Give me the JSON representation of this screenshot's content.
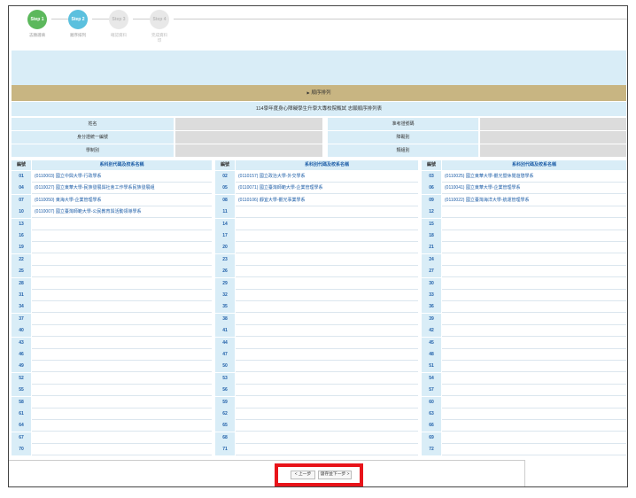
{
  "steps": [
    {
      "label": "Step 1",
      "caption": "志願選填",
      "state": "done"
    },
    {
      "label": "Step 2",
      "caption": "順序排列",
      "state": "current"
    },
    {
      "label": "Step 3",
      "caption": "確認資料",
      "state": "todo"
    },
    {
      "label": "Step 4",
      "caption": "完成資料\n印",
      "state": "todo"
    }
  ],
  "section_title": "順序排列",
  "section_arrow": "▶",
  "exam_title": "114學年度身心障礙學生升學大專校院甄試 志願順序排列表",
  "info": {
    "name_label": "姓名",
    "exam_no_label": "准考證號碼",
    "id_label": "身分證統一編號",
    "disability_label": "障礙別",
    "group_label": "學制別",
    "category_label": "類組別"
  },
  "table": {
    "no_header": "編號",
    "name_header": "系科別代碼及校系名稱",
    "columns": [
      [
        {
          "no": "01",
          "name": "(0110003) 國立中興大學-行政學系"
        },
        {
          "no": "04",
          "name": "(0110027) 國立東華大學-民族發展與社會工作學系民族發展組"
        },
        {
          "no": "07",
          "name": "(0110050) 東海大學-企業管理學系"
        },
        {
          "no": "10",
          "name": "(0110007) 國立臺灣師範大學-公民教育與活動領導學系"
        },
        {
          "no": "13",
          "name": ""
        },
        {
          "no": "16",
          "name": ""
        },
        {
          "no": "19",
          "name": ""
        },
        {
          "no": "22",
          "name": ""
        },
        {
          "no": "25",
          "name": ""
        },
        {
          "no": "28",
          "name": ""
        },
        {
          "no": "31",
          "name": ""
        },
        {
          "no": "34",
          "name": ""
        },
        {
          "no": "37",
          "name": ""
        },
        {
          "no": "40",
          "name": ""
        },
        {
          "no": "43",
          "name": ""
        },
        {
          "no": "46",
          "name": ""
        },
        {
          "no": "49",
          "name": ""
        },
        {
          "no": "52",
          "name": ""
        },
        {
          "no": "55",
          "name": ""
        },
        {
          "no": "58",
          "name": ""
        },
        {
          "no": "61",
          "name": ""
        },
        {
          "no": "64",
          "name": ""
        },
        {
          "no": "67",
          "name": ""
        },
        {
          "no": "70",
          "name": ""
        }
      ],
      [
        {
          "no": "02",
          "name": "(0110157) 國立政治大學-外交學系"
        },
        {
          "no": "05",
          "name": "(0110071) 國立臺灣師範大學-企業管理學系"
        },
        {
          "no": "08",
          "name": "(0110106) 靜宜大學-觀光事業學系"
        },
        {
          "no": "11",
          "name": ""
        },
        {
          "no": "14",
          "name": ""
        },
        {
          "no": "17",
          "name": ""
        },
        {
          "no": "20",
          "name": ""
        },
        {
          "no": "23",
          "name": ""
        },
        {
          "no": "26",
          "name": ""
        },
        {
          "no": "29",
          "name": ""
        },
        {
          "no": "32",
          "name": ""
        },
        {
          "no": "35",
          "name": ""
        },
        {
          "no": "38",
          "name": ""
        },
        {
          "no": "41",
          "name": ""
        },
        {
          "no": "44",
          "name": ""
        },
        {
          "no": "47",
          "name": ""
        },
        {
          "no": "50",
          "name": ""
        },
        {
          "no": "53",
          "name": ""
        },
        {
          "no": "56",
          "name": ""
        },
        {
          "no": "59",
          "name": ""
        },
        {
          "no": "62",
          "name": ""
        },
        {
          "no": "65",
          "name": ""
        },
        {
          "no": "68",
          "name": ""
        },
        {
          "no": "71",
          "name": ""
        }
      ],
      [
        {
          "no": "03",
          "name": "(0110025) 國立東華大學-觀光暨休閒遊憩學系"
        },
        {
          "no": "06",
          "name": "(0110041) 國立東華大學-企業管理學系"
        },
        {
          "no": "09",
          "name": "(0110022) 國立臺灣海洋大學-航運管理學系"
        },
        {
          "no": "12",
          "name": ""
        },
        {
          "no": "15",
          "name": ""
        },
        {
          "no": "18",
          "name": ""
        },
        {
          "no": "21",
          "name": ""
        },
        {
          "no": "24",
          "name": ""
        },
        {
          "no": "27",
          "name": ""
        },
        {
          "no": "30",
          "name": ""
        },
        {
          "no": "33",
          "name": ""
        },
        {
          "no": "36",
          "name": ""
        },
        {
          "no": "39",
          "name": ""
        },
        {
          "no": "42",
          "name": ""
        },
        {
          "no": "45",
          "name": ""
        },
        {
          "no": "48",
          "name": ""
        },
        {
          "no": "51",
          "name": ""
        },
        {
          "no": "54",
          "name": ""
        },
        {
          "no": "57",
          "name": ""
        },
        {
          "no": "60",
          "name": ""
        },
        {
          "no": "63",
          "name": ""
        },
        {
          "no": "66",
          "name": ""
        },
        {
          "no": "69",
          "name": ""
        },
        {
          "no": "72",
          "name": ""
        }
      ]
    ]
  },
  "buttons": {
    "prev": "< 上一步",
    "next": "儲存並下一步 >"
  },
  "colors": {
    "step_done": "#5cb85c",
    "step_current": "#5bc0de",
    "section_bar": "#c8b582",
    "header_bg": "#d9edf7",
    "highlight": "#e8141a"
  }
}
